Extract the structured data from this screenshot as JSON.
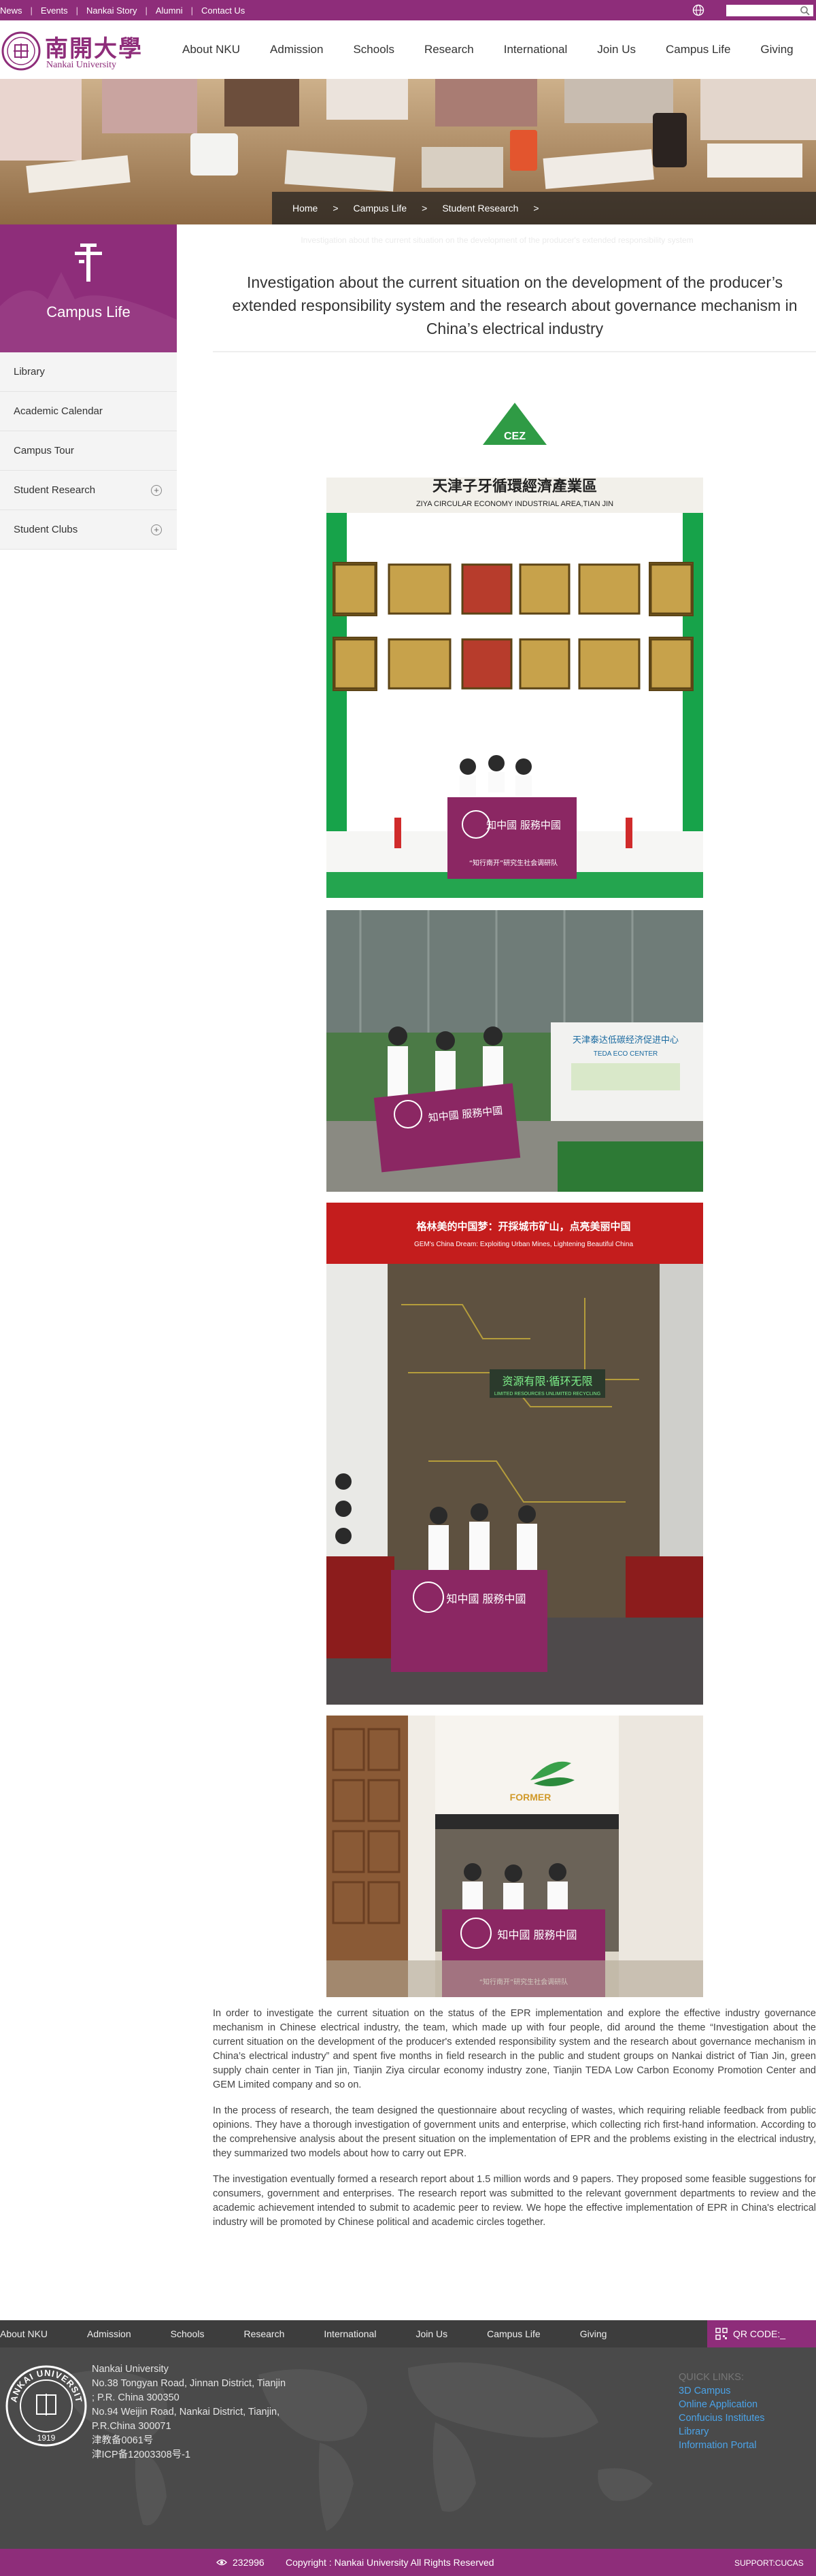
{
  "topbar": {
    "links": [
      "News",
      "Events",
      "Nankai Story",
      "Alumni",
      "Contact Us"
    ],
    "search_placeholder": ""
  },
  "logo": {
    "cn": "南開大學",
    "en": "Nankai University"
  },
  "main_nav": [
    "About NKU",
    "Admission",
    "Schools",
    "Research",
    "International",
    "Join Us",
    "Campus Life",
    "Giving"
  ],
  "breadcrumb": [
    "Home",
    "Campus Life",
    "Student Research"
  ],
  "breadcrumb_ghost": "Investigation about the current situation on the development of the producer's extended responsibility system",
  "sidebar": {
    "title": "Campus Life",
    "items": [
      {
        "label": "Library",
        "expandable": false
      },
      {
        "label": "Academic Calendar",
        "expandable": false
      },
      {
        "label": "Campus Tour",
        "expandable": false
      },
      {
        "label": "Student Research",
        "expandable": true
      },
      {
        "label": "Student Clubs",
        "expandable": true
      }
    ]
  },
  "article": {
    "title": "Investigation about the current situation on the development of the producer’s extended responsibility system and the research about governance mechanism in China’s electrical industry",
    "photos": {
      "p1_sign_cn": "天津子牙循環經濟產業區",
      "p1_sign_en": "ZIYA CIRCULAR ECONOMY INDUSTRIAL AREA,TIAN JIN",
      "banner_cn": "知中國 服務中國",
      "banner_sub": "“知行南开”研究生社会调研队",
      "p2_sign_cn": "天津泰达低碳经济促进中心",
      "p2_sign_en": "TEDA ECO CENTER",
      "p3_red_cn": "格林美的中国梦：开採城市矿山，点亮美丽中国",
      "p3_red_en": "GEM's China Dream: Exploiting Urban Mines, Lightening Beautiful China",
      "p3_green_cn": "资源有限·循环无限",
      "p3_green_en": "LIMITED RESOURCES UNLIMITED RECYCLING",
      "p4_logo": "FORMER"
    },
    "paragraphs": [
      "In order to investigate the current situation on the status of the EPR implementation and explore the effective industry governance mechanism in Chinese electrical industry, the team, which made up with four people, did around the theme “Investigation about the current situation on the development of the producer's extended responsibility system and the research about governance mechanism in China’s electrical industry” and spent five months in field research in the public and student groups on Nankai district of Tian Jin, green supply chain center in Tian jin, Tianjin Ziya circular economy industry zone, Tianjin TEDA Low Carbon Economy Promotion Center and GEM Limited company and so on.",
      "In the process of research, the team designed the questionnaire about recycling of wastes, which requiring reliable feedback from public opinions. They have a thorough investigation of government units and enterprise, which collecting rich first-hand information. According to the comprehensive analysis about the present situation on the implementation of EPR and the problems existing in the electrical industry, they summarized two models about how to carry out EPR.",
      "The investigation eventually formed a research report about 1.5 million words and 9 papers. They proposed some feasible suggestions for consumers, government and enterprises. The research report was submitted to the relevant government departments to review and the academic achievement intended to submit to academic peer to review. We hope the effective implementation of EPR in China's electrical industry will be promoted by Chinese political and academic circles together."
    ]
  },
  "footer": {
    "nav": [
      "About NKU",
      "Admission",
      "Schools",
      "Research",
      "International",
      "Join Us",
      "Campus Life",
      "Giving"
    ],
    "qr_label": "QR CODE:_",
    "seal_text": "NANKAI UNIVERSITY",
    "seal_year": "1919",
    "address": [
      "Nankai University",
      "No.38 Tongyan Road, Jinnan District, Tianjin",
      "; P.R. China 300350",
      "No.94 Weijin Road,  Nankai District, Tianjin,",
      "P.R.China  300071",
      "津教备0061号",
      "津ICP备12003308号-1"
    ],
    "quick_links_head": "QUICK LINKS:",
    "quick_links": [
      "3D Campus",
      "Online Application",
      "Confucius Institutes",
      "Library",
      "Information Portal"
    ],
    "visits": "232996",
    "copyright": "Copyright : Nankai University All Rights Reserved",
    "support": "SUPPORT:CUCAS"
  },
  "colors": {
    "brand": "#8e2d7a",
    "link": "#4aa3e8",
    "footer_bg": "#4a4a4a"
  },
  "icons": [
    "globe-icon",
    "search-icon",
    "plus-circle-icon",
    "qr-code-icon",
    "eye-icon"
  ]
}
